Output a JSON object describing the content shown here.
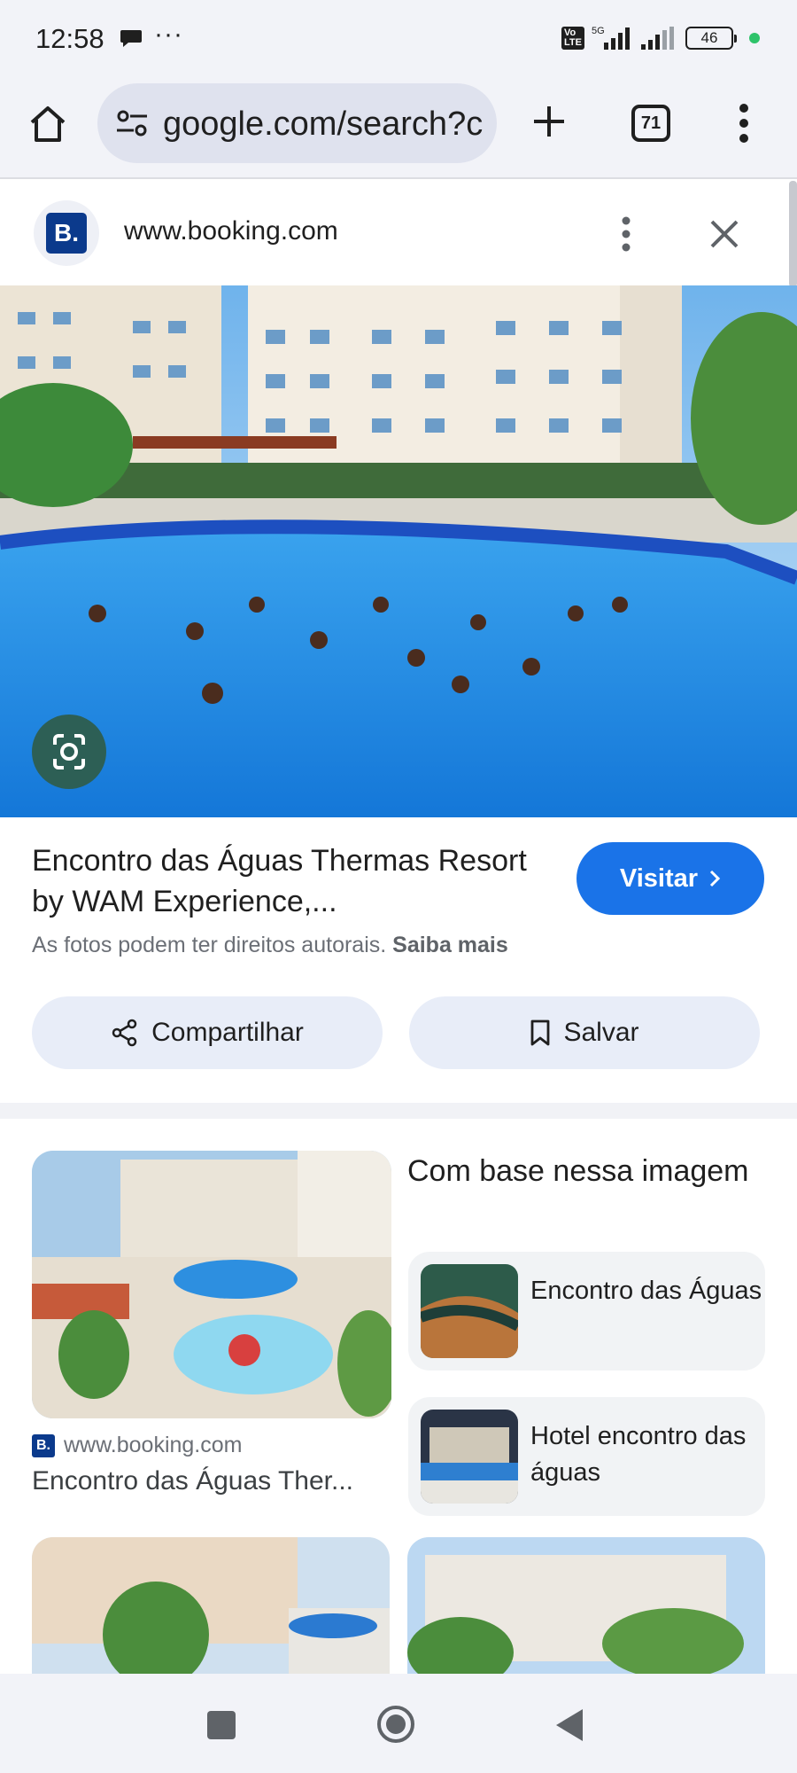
{
  "status_bar": {
    "time": "12:58",
    "more": "···",
    "network": "5G",
    "battery": "46",
    "icons": [
      "chat-bubble-icon",
      "volte-icon",
      "signal-icon",
      "battery-icon"
    ]
  },
  "browser": {
    "url": "google.com/search?c",
    "tab_count": "71",
    "icons": [
      "home-icon",
      "site-settings-icon",
      "new-tab-icon",
      "tab-switcher-icon",
      "more-vert-icon"
    ]
  },
  "panel": {
    "logo_letter": "B.",
    "site_url": "www.booking.com",
    "title": "Encontro das Águas Thermas Resort by WAM Experience,...",
    "visit_label": "Visitar",
    "copyright_text": "As fotos podem ter direitos autorais.",
    "learn_more": "Saiba mais",
    "share_label": "Compartilhar",
    "save_label": "Salvar"
  },
  "related": {
    "source_logo": "B.",
    "source_url": "www.booking.com",
    "caption": "Encontro das Águas Ther...",
    "section_title": "Com base nessa imagem",
    "chips": [
      {
        "label": "Encontro das Águas"
      },
      {
        "label": "Hotel encontro das águas"
      }
    ]
  },
  "colors": {
    "accent": "#1a73e8",
    "chrome_bg": "#f2f3f8",
    "booking_blue": "#0b3a8c",
    "action_bg": "#e8edf8"
  }
}
